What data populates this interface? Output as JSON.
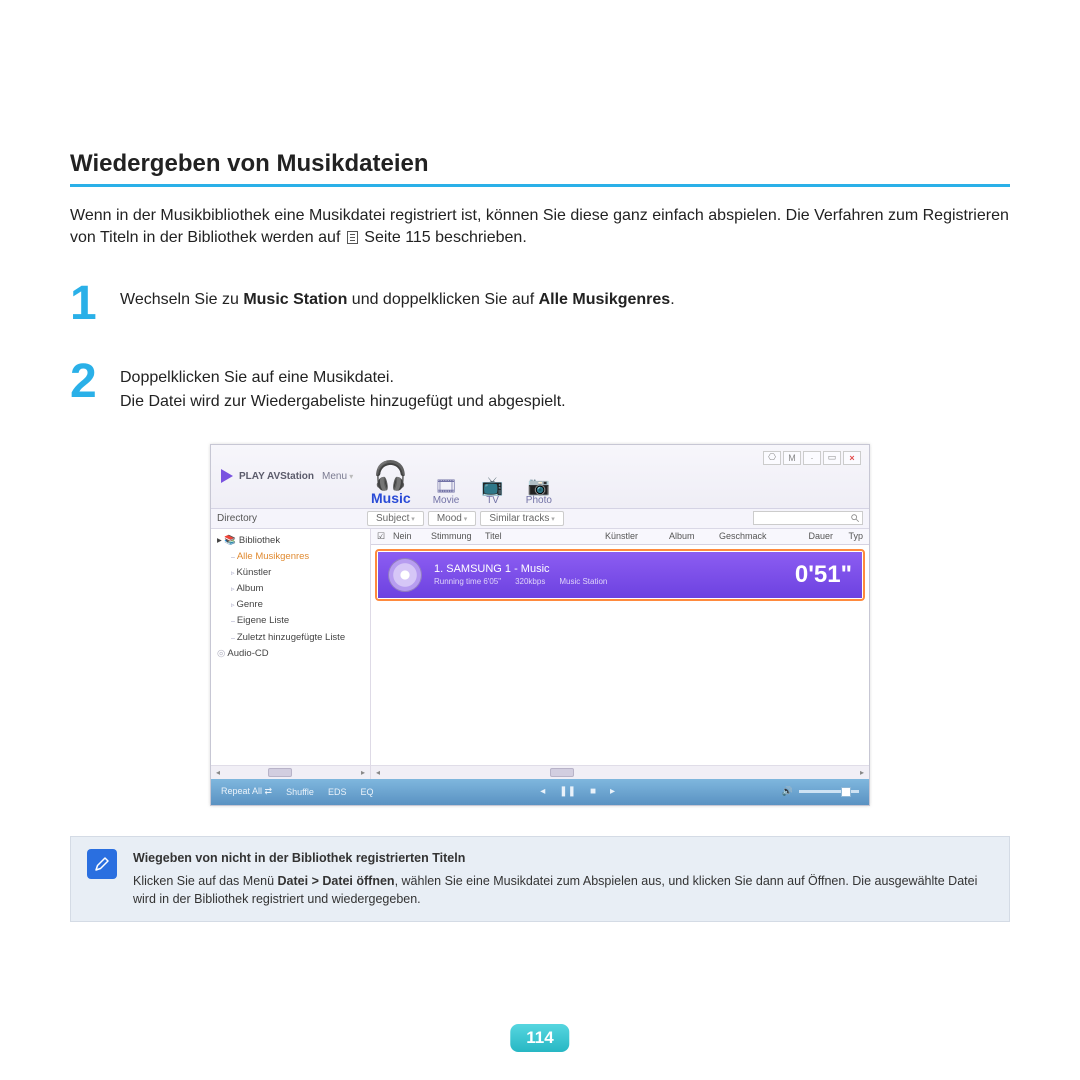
{
  "title": "Wiedergeben von Musikdateien",
  "intro_a": "Wenn in der Musikbibliothek eine Musikdatei registriert ist, können Sie diese ganz einfach abspielen. Die Verfahren zum Registrieren von Titeln in der Bibliothek werden auf ",
  "intro_b": " Seite 115 beschrieben.",
  "steps": [
    {
      "num": "1",
      "pre": "Wechseln Sie zu ",
      "b1": "Music Station",
      "mid": " und doppelklicken Sie auf ",
      "b2": "Alle Musikgenres",
      "post": "."
    },
    {
      "num": "2",
      "line1": "Doppelklicken Sie auf eine Musikdatei.",
      "line2": "Die Datei wird zur Wiedergabeliste hinzugefügt und abgespielt."
    }
  ],
  "app": {
    "brand": "PLAY AVStation",
    "menu": "Menu",
    "win_buttons": [
      "⎔",
      "M",
      "·",
      "▭",
      "×"
    ],
    "tabs": {
      "music": "Music",
      "movie": "Movie",
      "tv": "TV",
      "photo": "Photo"
    },
    "dir_label": "Directory",
    "filters": {
      "subject": "Subject",
      "mood": "Mood",
      "similar": "Similar tracks"
    },
    "tree": {
      "root": "Bibliothek",
      "items": [
        "Alle Musikgenres",
        "Künstler",
        "Album",
        "Genre",
        "Eigene Liste",
        "Zuletzt hinzugefügte Liste"
      ],
      "cd": "Audio-CD"
    },
    "columns": [
      "Nein",
      "Stimmung",
      "Titel",
      "Künstler",
      "Album",
      "Geschmack",
      "Dauer",
      "Typ"
    ],
    "now_playing": {
      "track": "1.  SAMSUNG 1 - Music",
      "runtime": "Running time 6'05\"",
      "bitrate": "320kbps",
      "source": "Music Station",
      "elapsed": "0'51\""
    },
    "footer": {
      "repeat": "Repeat All",
      "shuffle": "Shuffle",
      "eds": "EDS",
      "eq": "EQ"
    }
  },
  "note": {
    "title": "Wiegeben von nicht in der Bibliothek registrierten Titeln",
    "pre": "Klicken Sie auf das Menü ",
    "bold": "Datei > Datei öffnen",
    "post": ", wählen Sie eine Musikdatei zum Abspielen aus, und klicken Sie dann auf Öffnen. Die ausgewählte Datei wird in der Bibliothek registriert und wiedergegeben."
  },
  "page_number": "114"
}
